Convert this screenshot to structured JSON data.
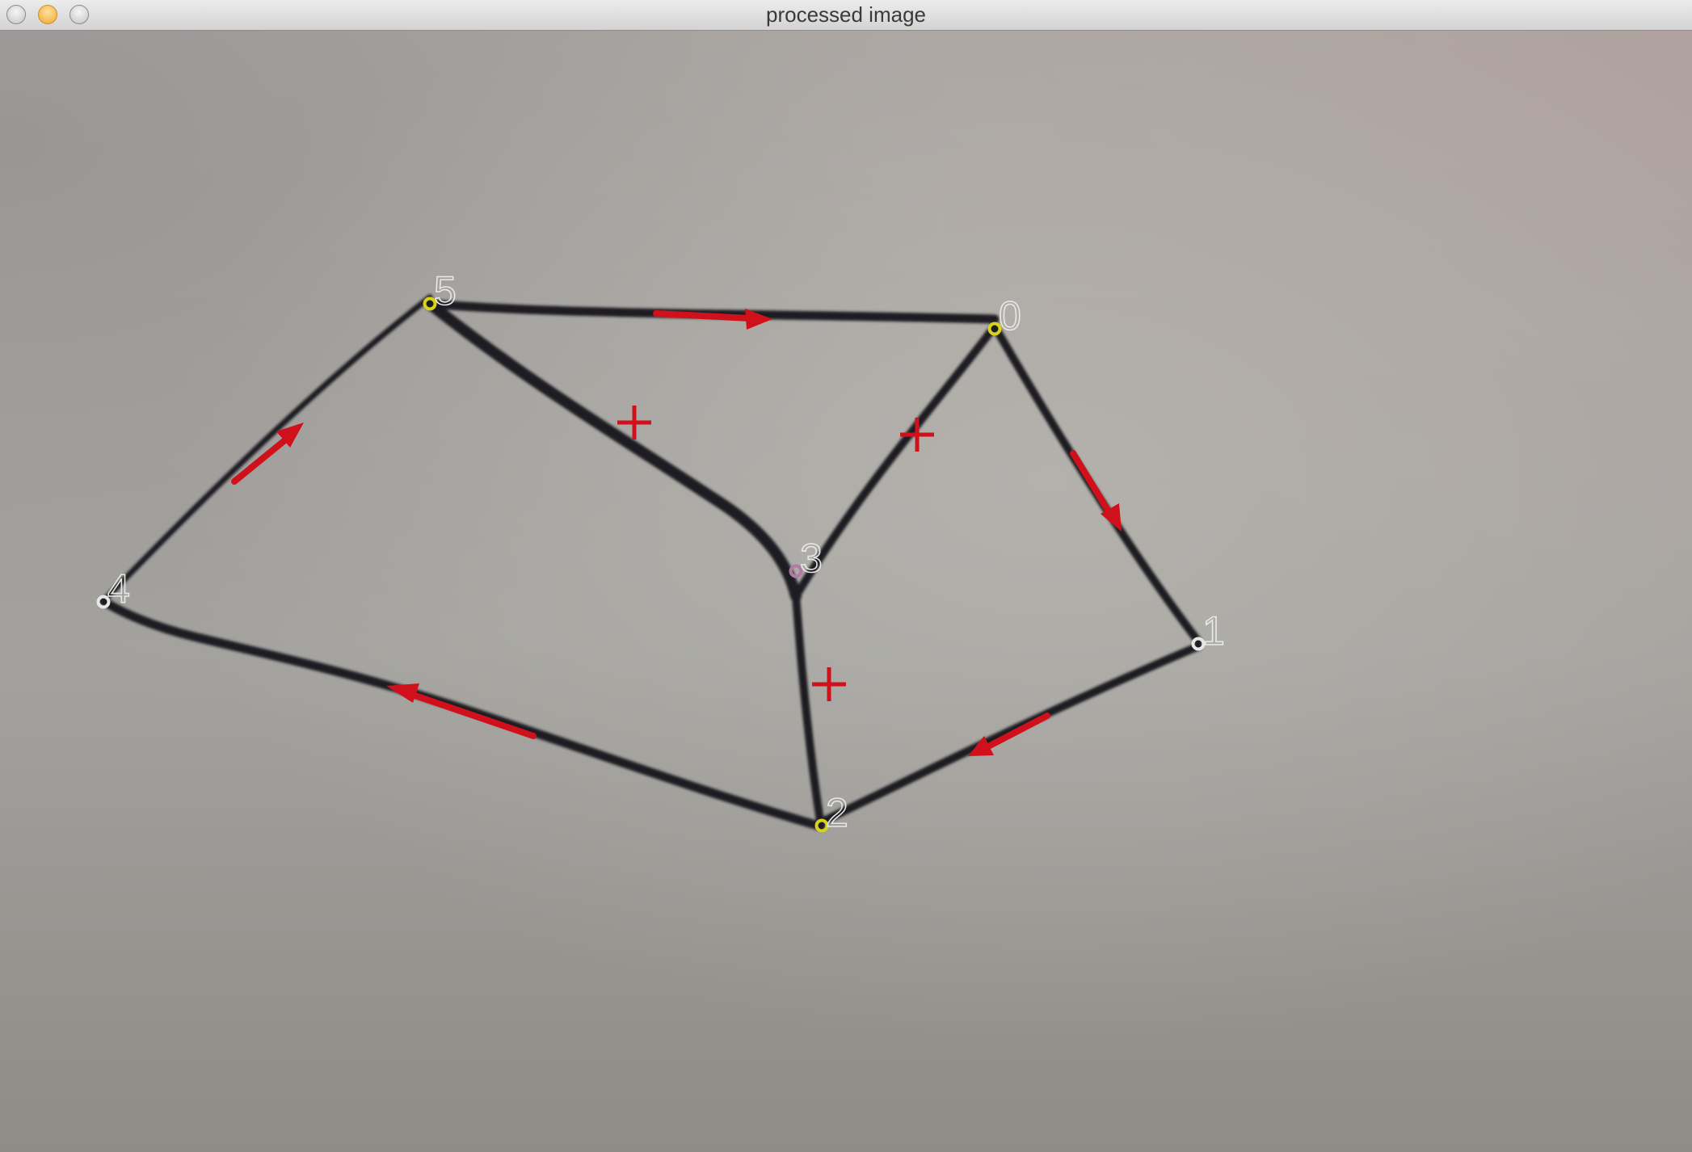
{
  "window": {
    "title": "processed image"
  },
  "graph": {
    "nodes": [
      {
        "id": "0",
        "label": "0",
        "marker_color": "#d8d21a"
      },
      {
        "id": "1",
        "label": "1",
        "marker_color": "#e6e6e6"
      },
      {
        "id": "2",
        "label": "2",
        "marker_color": "#d8d21a"
      },
      {
        "id": "3",
        "label": "3",
        "marker_color": "#b07aa6"
      },
      {
        "id": "4",
        "label": "4",
        "marker_color": "#e6e6e6"
      },
      {
        "id": "5",
        "label": "5",
        "marker_color": "#d8d21a"
      }
    ],
    "edges": [
      [
        "5",
        "0"
      ],
      [
        "0",
        "1"
      ],
      [
        "1",
        "2"
      ],
      [
        "2",
        "4"
      ],
      [
        "4",
        "5"
      ],
      [
        "5",
        "3"
      ],
      [
        "0",
        "3"
      ],
      [
        "3",
        "2"
      ]
    ],
    "direction_arrows": [
      {
        "from": "5",
        "to": "0"
      },
      {
        "from": "0",
        "to": "1"
      },
      {
        "from": "1",
        "to": "2"
      },
      {
        "from": "2",
        "to": "4"
      },
      {
        "from": "4",
        "to": "5"
      }
    ],
    "cross_markers": 3,
    "colors": {
      "edge": "#1c1c22",
      "arrow": "#d0101a",
      "cross": "#d0101a",
      "label": "#e8e8e8"
    }
  }
}
